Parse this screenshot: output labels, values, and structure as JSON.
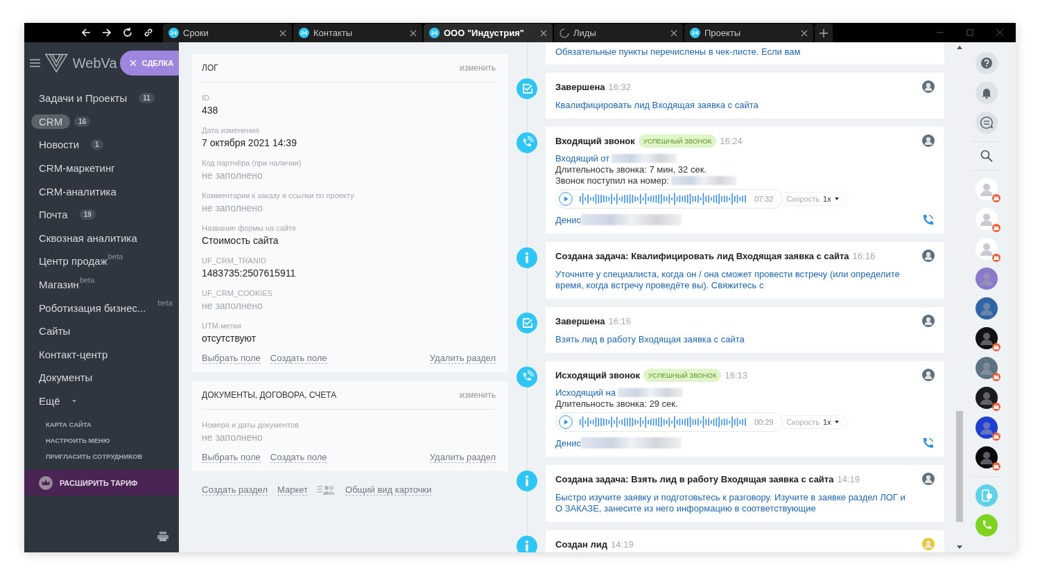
{
  "browser": {
    "tabs": [
      {
        "label": "Сроки",
        "badge": "24",
        "loading": false,
        "selected": false
      },
      {
        "label": "Контакты",
        "badge": "24",
        "loading": false,
        "selected": false
      },
      {
        "label": "ООО \"Индустрия\"",
        "badge": "24",
        "loading": false,
        "selected": true
      },
      {
        "label": "Лиды",
        "loading": true,
        "selected": false
      },
      {
        "label": "Проекты",
        "badge": "24",
        "loading": false,
        "selected": false
      }
    ]
  },
  "sidebar": {
    "logo": "WebVa",
    "deal_button": "СДЕЛКА",
    "items": [
      {
        "label": "Задачи и Проекты",
        "badge": "11",
        "selected": false
      },
      {
        "label": "CRM",
        "badge": "16",
        "selected": true
      },
      {
        "label": "Новости",
        "badge": "1",
        "selected": false
      },
      {
        "label": "CRM-маркетинг",
        "selected": false
      },
      {
        "label": "CRM-аналитика",
        "selected": false
      },
      {
        "label": "Почта",
        "badge": "19",
        "selected": false
      },
      {
        "label": "Сквозная аналитика",
        "selected": false
      },
      {
        "label": "Центр продаж",
        "beta": "beta",
        "selected": false
      },
      {
        "label": "Магазин",
        "beta": "beta",
        "selected": false
      },
      {
        "label": "Роботизация бизнес...",
        "beta": "beta",
        "beta_far": true,
        "selected": false
      },
      {
        "label": "Сайты",
        "selected": false
      },
      {
        "label": "Контакт-центр",
        "selected": false
      },
      {
        "label": "Документы",
        "selected": false
      },
      {
        "label": "Ещё",
        "caret": true,
        "selected": false
      }
    ],
    "links": [
      "КАРТА САЙТА",
      "НАСТРОИТЬ МЕНЮ",
      "ПРИГЛАСИТЬ СОТРУДНИКОВ"
    ],
    "upgrade": "РАСШИРИТЬ ТАРИФ"
  },
  "sections": [
    {
      "title": "ЛОГ",
      "edit": "изменить",
      "fields": [
        {
          "label": "ID",
          "value": "438",
          "empty": false
        },
        {
          "label": "Дата изменения",
          "value": "7 октября 2021 14:39",
          "empty": false
        },
        {
          "label": "Код партнёра (при наличии)",
          "value": "не заполнено",
          "empty": true
        },
        {
          "label": "Комментарии к заказу и ссылки по проекту",
          "value": "не заполнено",
          "empty": true
        },
        {
          "label": "Название формы на сайте",
          "value": "Стоимость сайта",
          "empty": false
        },
        {
          "label": "UF_CRM_TRANID",
          "value": "1483735:2507615911",
          "empty": false
        },
        {
          "label": "UF_CRM_COOKIES",
          "value": "не заполнено",
          "empty": true
        },
        {
          "label": "UTM-метки",
          "value": "отсутствуют",
          "empty": false
        }
      ],
      "actions": [
        "Выбрать поле",
        "Создать поле"
      ],
      "delete": "Удалить раздел"
    },
    {
      "title": "ДОКУМЕНТЫ, ДОГОВОРА, СЧЕТА",
      "edit": "изменить",
      "fields": [
        {
          "label": "Номера и даты документов",
          "value": "не заполнено",
          "empty": true
        }
      ],
      "actions": [
        "Выбрать поле",
        "Создать поле"
      ],
      "delete": "Удалить раздел"
    }
  ],
  "footer_links": [
    "Создать раздел",
    "Маркет",
    "Общий вид карточки"
  ],
  "timeline": [
    {
      "kind": "note",
      "text": "Обязательные пункты перечислены в чек-листе. Если вам"
    },
    {
      "kind": "task_done",
      "title": "Завершена",
      "time": "16:32",
      "link": "Квалифицировать лид Входящая заявка с сайта",
      "color": "#5b6f82"
    },
    {
      "kind": "call",
      "title": "Входящий звонок",
      "badge": "УСПЕШНЫЙ ЗВОНОК",
      "time": "16:24",
      "color": "#5b6f82",
      "lines": [
        {
          "text": "Входящий от",
          "link": true,
          "redacted": true
        },
        {
          "text": "Длительность звонка: 7 мин, 32 сек.",
          "link": false,
          "redacted": false
        },
        {
          "text": "Звонок поступил на номер:",
          "link": false,
          "redacted": true
        }
      ],
      "duration": "07:32",
      "speed_label": "Скорость",
      "speed": "1x",
      "person": "Денис"
    },
    {
      "kind": "task_created",
      "title": "Создана задача: Квалифицировать лид Входящая заявка с сайта",
      "time": "16:16",
      "color": "#5b6f82",
      "text": "Уточните у специалиста, когда он / она  сможет провести встречу (или определите время, когда встречу проведёте вы). Свяжитесь с"
    },
    {
      "kind": "task_done",
      "title": "Завершена",
      "time": "16:16",
      "link": "Взять лид в работу Входящая заявка с сайта",
      "color": "#5b6f82"
    },
    {
      "kind": "call",
      "title": "Исходящий звонок",
      "badge": "УСПЕШНЫЙ ЗВОНОК",
      "time": "16:13",
      "color": "#5b6f82",
      "lines": [
        {
          "text": "Исходящий на",
          "link": true,
          "redacted": true
        },
        {
          "text": "Длительность звонка: 29 сек.",
          "link": false,
          "redacted": false
        }
      ],
      "duration": "00:29",
      "speed_label": "Скорость",
      "speed": "1x",
      "person": "Денис"
    },
    {
      "kind": "task_created",
      "title": "Создана задача: Взять лид в работу Входящая заявка с сайта",
      "time": "14:19",
      "color": "#5b6f82",
      "text": "Быстро изучите заявку и подготовьтесь к разговору. Изучите в заявке раздел ЛОГ и О ЗАКАЗЕ, занесите из него информацию в соответствующие"
    },
    {
      "kind": "lead",
      "title": "Создан лид",
      "time": "14:19",
      "color": "#e9c927"
    }
  ],
  "rail": {
    "chats": [
      {
        "color": "#ffffff",
        "group": true
      },
      {
        "color": "#ffffff",
        "group": true
      },
      {
        "color": "#ffffff",
        "group": true
      },
      {
        "color": "#8a78c9",
        "group": false
      },
      {
        "color": "#2d65a5",
        "group": false
      },
      {
        "color": "#111111",
        "group": true
      },
      {
        "color": "#5d7282",
        "group": true
      },
      {
        "color": "#1c1c1c",
        "group": true
      },
      {
        "color": "#1f3fd0",
        "group": true
      },
      {
        "color": "#0a0a0a",
        "group": true
      }
    ]
  }
}
